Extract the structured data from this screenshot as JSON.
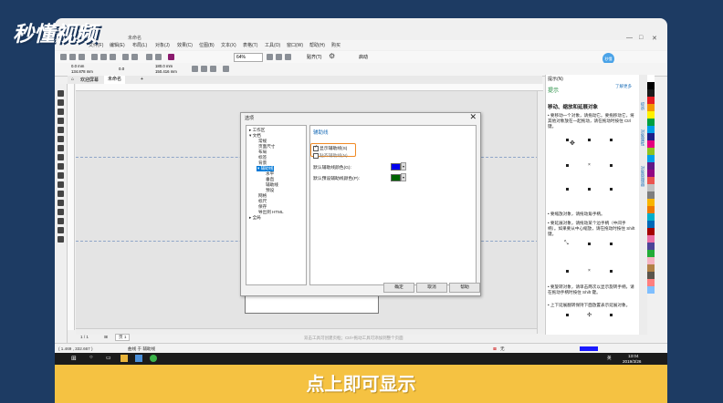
{
  "brand": {
    "logo_text": "秒懂视频"
  },
  "app": {
    "doc_title": "未命名",
    "window_controls": [
      "—",
      "□",
      "✕"
    ]
  },
  "menu": [
    "文件(F)",
    "编辑(E)",
    "布局(L)",
    "对象(J)",
    "效果(C)",
    "位图(B)",
    "文本(X)",
    "表格(T)",
    "工具(O)",
    "窗口(W)",
    "帮助(H)",
    "购买"
  ],
  "toolbar": {
    "zoom": "64%",
    "snap_label": "贴齐(T)",
    "launch_label": "启动",
    "x_value": "0.0 mm",
    "y_value": "134.878 mm",
    "w_value": "180.0 mm",
    "h_value": "150.416 mm",
    "angle": "0.0",
    "user_badge": "秒懂"
  },
  "tabs": [
    {
      "label": "欢迎屏幕"
    },
    {
      "label": "未命名"
    }
  ],
  "dialog": {
    "title": "选项",
    "close": "✕",
    "tree": [
      {
        "label": "▸ 工作区",
        "level": 0
      },
      {
        "label": "▾ 文档",
        "level": 0
      },
      {
        "label": "常规",
        "level": 1
      },
      {
        "label": "页面尺寸",
        "level": 1
      },
      {
        "label": "布局",
        "level": 1
      },
      {
        "label": "标签",
        "level": 1
      },
      {
        "label": "背景",
        "level": 1
      },
      {
        "label": "▾ 辅助线",
        "level": 1,
        "selected": true
      },
      {
        "label": "水平",
        "level": 2
      },
      {
        "label": "垂直",
        "level": 2
      },
      {
        "label": "辅助线",
        "level": 2
      },
      {
        "label": "预设",
        "level": 2
      },
      {
        "label": "网格",
        "level": 1
      },
      {
        "label": "标尺",
        "level": 1
      },
      {
        "label": "保存",
        "level": 1
      },
      {
        "label": "导出到 HTML",
        "level": 1
      },
      {
        "label": "▸ 全局",
        "level": 0
      }
    ],
    "section_title": "辅助线",
    "show_guides_label": "显示辅助线(S)",
    "snap_guides_label": "贴齐辅助线(N)",
    "default_guide_color_label": "默认辅助线颜色(G):",
    "default_preset_color_label": "默认预设辅助线颜色(P):",
    "guide_color": "#0000ee",
    "preset_color": "#006400",
    "buttons": {
      "ok": "确定",
      "cancel": "取消",
      "help": "帮助"
    }
  },
  "pages": {
    "counter": "1 / 1",
    "page_tab": "页 1"
  },
  "hints": {
    "canvas_hint": "双击工具可创建页框；Ctrl+拖动工具可添加到整个页面"
  },
  "status": {
    "coords": "( 1.469 , 332.667 )",
    "tool_info": "曲线 于 辅助线",
    "fill_none": "无"
  },
  "right_panel": {
    "title": "提示(N)",
    "head": "提示",
    "link": "了解更多",
    "heading": "移动、缩放和延展对象",
    "paragraphs": [
      "• 要移动一个对象，请拖动它。要拖移动它，将其他对象放在一起拖动，请在拖动时按住 Ctrl 键。",
      "• 要缩放对象，请拖动角手柄。",
      "• 要延展对象，请拖动某个边手柄（中间手柄）。如果要从中心缩放，请在拖动时按住 Shift 键。",
      "• 要旋转对象，请单击两次以显示旋转手柄，请在拖动手柄时按住 Shift 键。",
      "• 上下延展翻转保持下面放置表示延展对象。"
    ],
    "side_tabs": [
      "提示",
      "对象属性",
      "对象管理器"
    ]
  },
  "taskbar": {
    "time": "13:04",
    "date": "2019/3/26",
    "lang": "英"
  },
  "caption": {
    "text": "点上即可显示"
  },
  "palette_colors": [
    "#ffffff",
    "#000000",
    "#1a1a1a",
    "#e61e25",
    "#f39800",
    "#fff100",
    "#00a040",
    "#009fe8",
    "#1d2088",
    "#e4007f",
    "#8fc31f",
    "#00a0e9",
    "#601986",
    "#920783",
    "#ea5550",
    "#c0c0c0",
    "#7f7f7f",
    "#f8b500",
    "#ee7800",
    "#00afcc",
    "#0068b7",
    "#a40000",
    "#eb6ea5",
    "#4d4398",
    "#22ac38",
    "#f4b3c2",
    "#b28146",
    "#5a544b",
    "#ff7f7f",
    "#7fbfff"
  ]
}
